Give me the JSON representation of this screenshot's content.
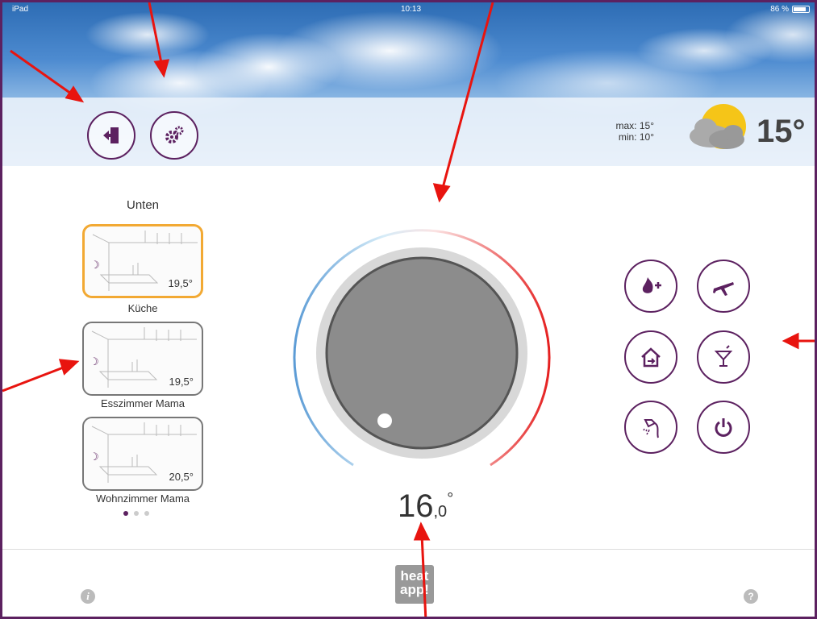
{
  "status": {
    "device": "iPad",
    "time": "10:13",
    "battery": "86 %"
  },
  "header": {
    "logout_icon": "logout-door-icon",
    "settings_icon": "gears-icon"
  },
  "weather": {
    "max": "max: 15°",
    "min": "min: 10°",
    "temp": "15°",
    "icon": "cloud-sun-icon"
  },
  "rooms": {
    "floor": "Unten",
    "items": [
      {
        "name": "Küche",
        "temp": "19,5°",
        "active": true
      },
      {
        "name": "Esszimmer Mama",
        "temp": "19,5°",
        "active": false
      },
      {
        "name": "Wohnzimmer Mama",
        "temp": "20,5°",
        "active": false
      }
    ],
    "page": 1,
    "pages": 3
  },
  "thermostat": {
    "setpoint_int": "16",
    "setpoint_dec": ",0",
    "unit": "°"
  },
  "modes": [
    {
      "name": "boost-heating",
      "icon": "flame-plus-icon"
    },
    {
      "name": "vacation",
      "icon": "airplane-icon"
    },
    {
      "name": "away-home",
      "icon": "house-arrow-icon"
    },
    {
      "name": "party",
      "icon": "cocktail-icon"
    },
    {
      "name": "shower",
      "icon": "shower-icon"
    },
    {
      "name": "power",
      "icon": "power-icon"
    }
  ],
  "footer": {
    "logo_line1": "heat",
    "logo_line2": "app!",
    "info": "i",
    "help": "?"
  },
  "colors": {
    "accent": "#5c2160",
    "active_room": "#f2a933",
    "annotation": "#e8140f"
  }
}
